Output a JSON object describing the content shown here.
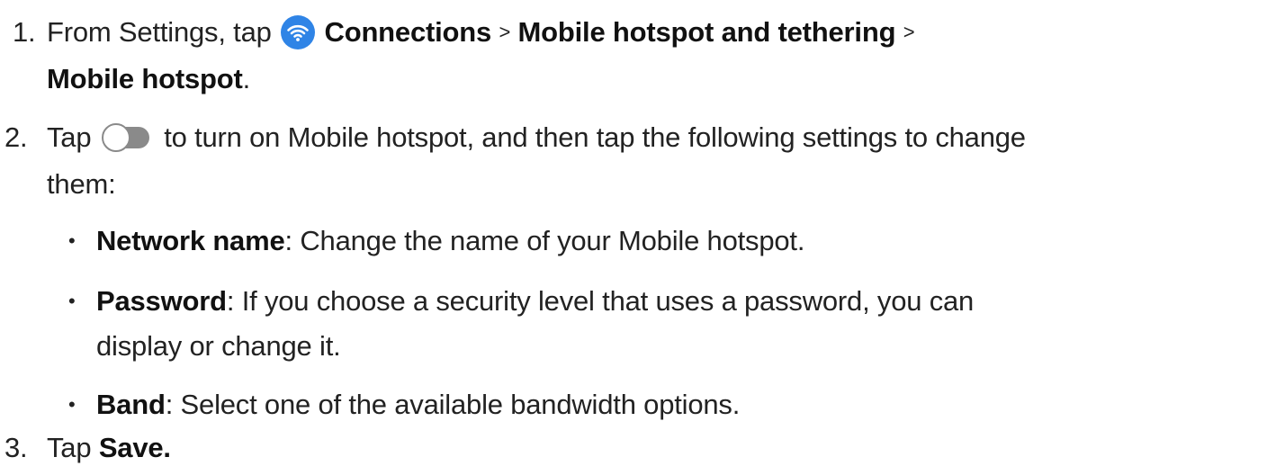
{
  "steps": [
    {
      "number": "1.",
      "parts": {
        "a": "From Settings, tap",
        "b": "Connections",
        "c": ">",
        "d": "Mobile hotspot and tethering",
        "e": ">",
        "f": "Mobile hotspot",
        "g": "."
      }
    },
    {
      "number": "2.",
      "parts": {
        "a": "Tap",
        "b": "to turn on Mobile hotspot, and then tap the following settings to change",
        "c": "them:"
      },
      "bullets": [
        {
          "symbol": "•",
          "term": "Network name",
          "colon": ":",
          "text": "Change the name of your Mobile hotspot."
        },
        {
          "symbol": "•",
          "term": "Password",
          "colon": ":",
          "text": "If you choose a security level that uses a password, you can",
          "text2": "display or change it."
        },
        {
          "symbol": "•",
          "term": "Band",
          "colon": ":",
          "text": "Select one of the available bandwidth options."
        }
      ]
    },
    {
      "number": "3.",
      "parts": {
        "a": "Tap",
        "b": "Save",
        "c": "."
      }
    }
  ],
  "icons": {
    "connections": "wifi-icon",
    "toggle": "toggle-switch-icon"
  },
  "colors": {
    "icon_blue": "#2f84e6",
    "toggle_track": "#8a8a8a",
    "text": "#222222"
  }
}
